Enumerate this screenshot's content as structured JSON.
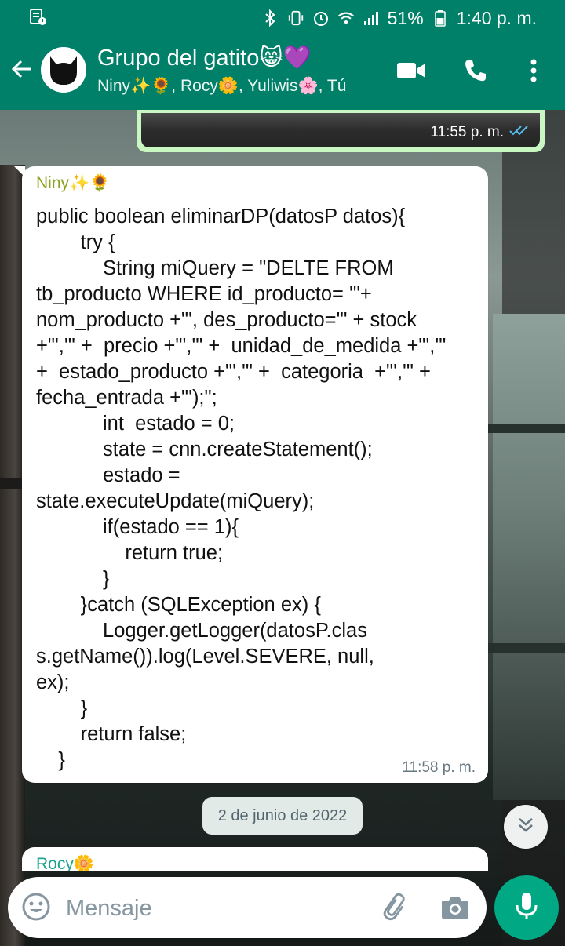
{
  "status_bar": {
    "battery": "51%",
    "time": "1:40 p. m."
  },
  "header": {
    "title": "Grupo del gatito😸💜",
    "members": "Niny✨🌻, Rocy🌼, Yuliwis🌸, Tú"
  },
  "messages": {
    "previous_outgoing_time": "11:55 p. m.",
    "incoming": {
      "sender": "Niny✨🌻",
      "text": "public boolean eliminarDP(datosP datos){\n        try {\n            String miQuery = \"DELTE FROM\ntb_producto WHERE id_producto= '\"+\nnom_producto +\"', des_producto='\" + stock\n+\"','\" +  precio +\"','\" +  unidad_de_medida +\"','\"\n+  estado_producto +\"','\" +  categoria  +\"','\" +\nfecha_entrada +\"');\";\n            int  estado = 0;\n            state = cnn.createStatement();\n            estado =\nstate.executeUpdate(miQuery);\n            if(estado == 1){\n                return true;\n            }\n        }catch (SQLException ex) {\n            Logger.getLogger(datosP.clas\ns.getName()).log(Level.SEVERE, null,\nex);\n        }\n        return false;\n    }",
      "time": "11:58 p. m."
    },
    "date_divider": "2 de junio de 2022",
    "next_sender": "Rocy🌼"
  },
  "composer": {
    "placeholder": "Mensaje"
  },
  "icons": {
    "back": "arrow-left-icon",
    "video": "video-call-icon",
    "call": "phone-icon",
    "more": "more-vertical-icon",
    "emoji": "emoji-icon",
    "attach": "paperclip-icon",
    "camera": "camera-icon",
    "mic": "microphone-icon",
    "scroll": "chevron-double-down-icon"
  },
  "colors": {
    "brand": "#008069",
    "outgoing_bubble": "#c9f7c2",
    "sender_name": "#8aa31f",
    "mic_button": "#00a884"
  }
}
